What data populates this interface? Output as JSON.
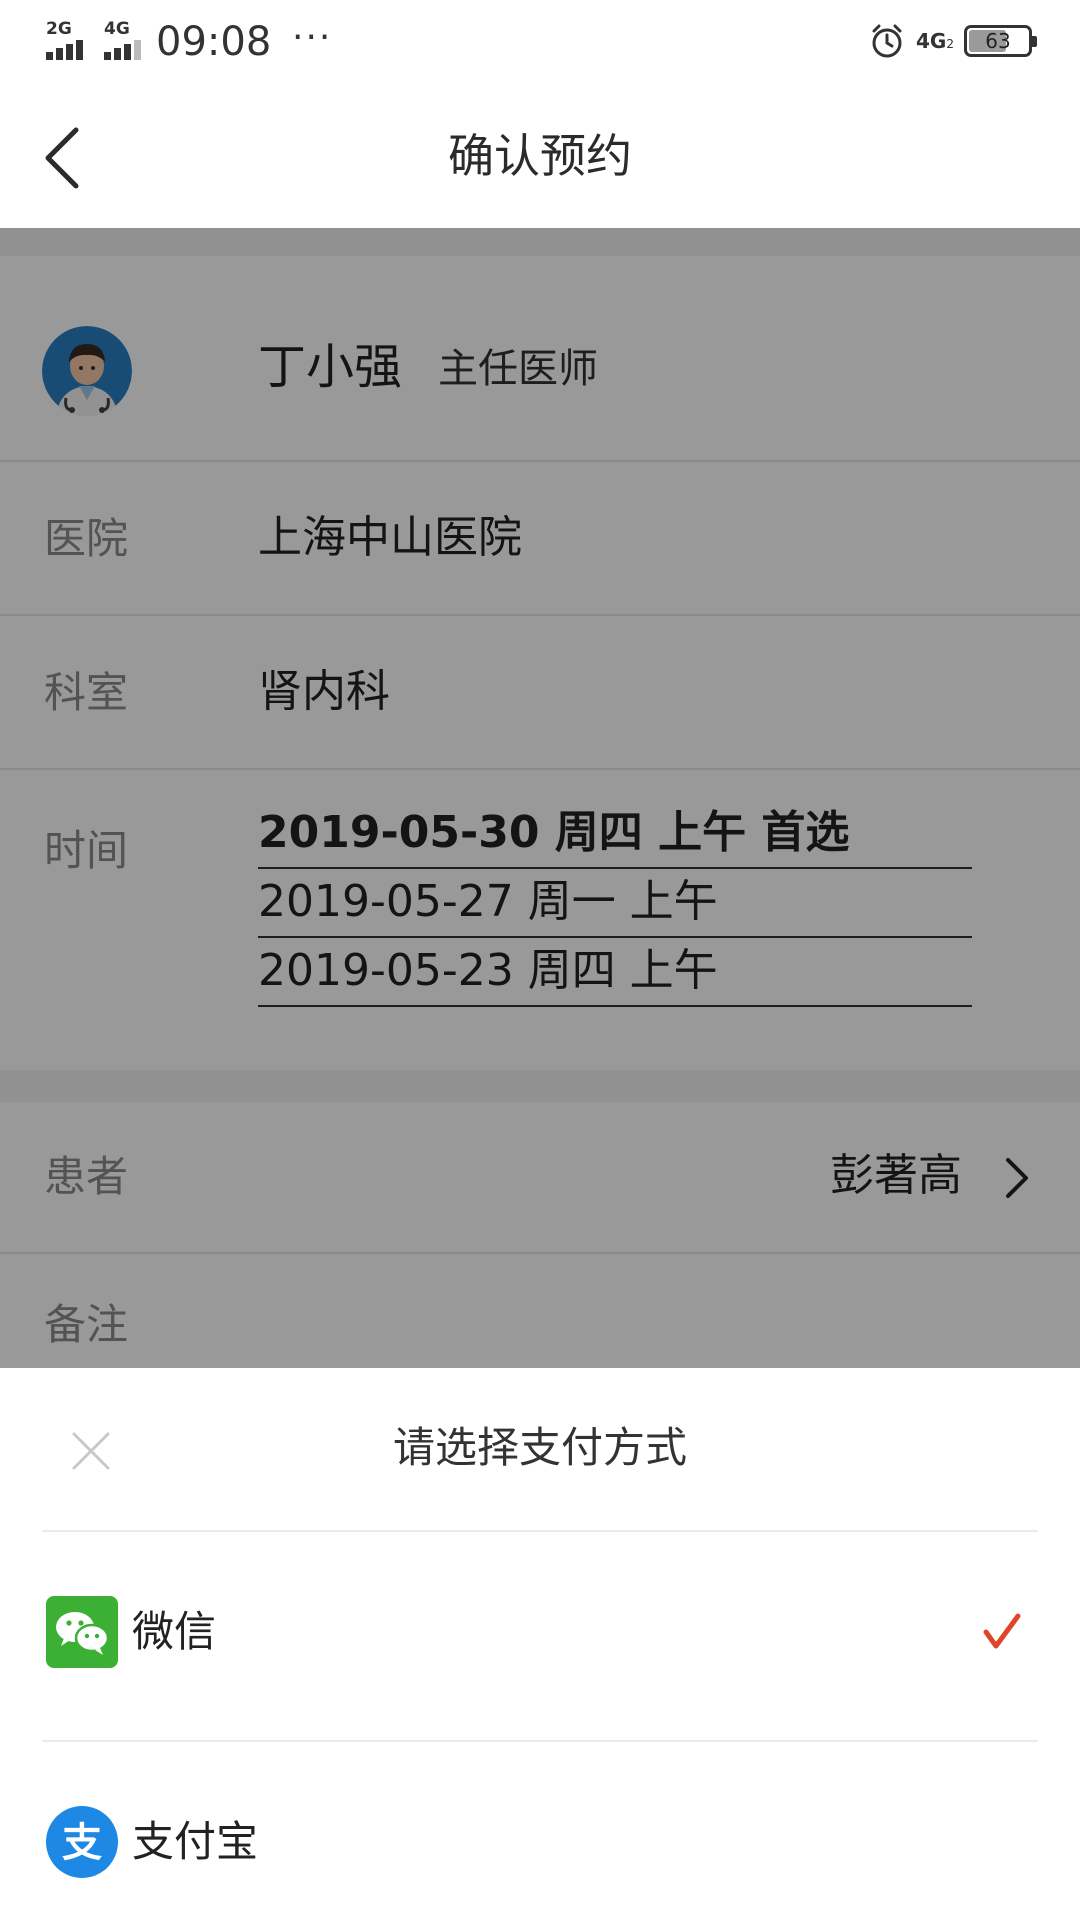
{
  "status_bar": {
    "signal_1": "2G",
    "signal_2": "4G",
    "time": "09:08",
    "more": "···",
    "net": "4G",
    "net_sub": "2",
    "battery": "63"
  },
  "nav": {
    "title": "确认预约"
  },
  "doctor": {
    "name": "丁小强",
    "title": "主任医师"
  },
  "rows": {
    "hospital": {
      "label": "医院",
      "value": "上海中山医院"
    },
    "department": {
      "label": "科室",
      "value": "肾内科"
    },
    "time": {
      "label": "时间",
      "options": [
        "2019-05-30 周四 上午 首选",
        "2019-05-27 周一 上午",
        "2019-05-23 周四 上午"
      ]
    },
    "patient": {
      "label": "患者",
      "value": "彭著高"
    },
    "note": {
      "label": "备注"
    }
  },
  "payment_sheet": {
    "title": "请选择支付方式",
    "options": [
      {
        "label": "微信",
        "icon": "wechat-icon",
        "selected": true
      },
      {
        "label": "支付宝",
        "icon": "alipay-icon",
        "selected": false
      }
    ]
  },
  "colors": {
    "wechat": "#3cb034",
    "alipay": "#1e88e5",
    "check": "#e0452b"
  }
}
